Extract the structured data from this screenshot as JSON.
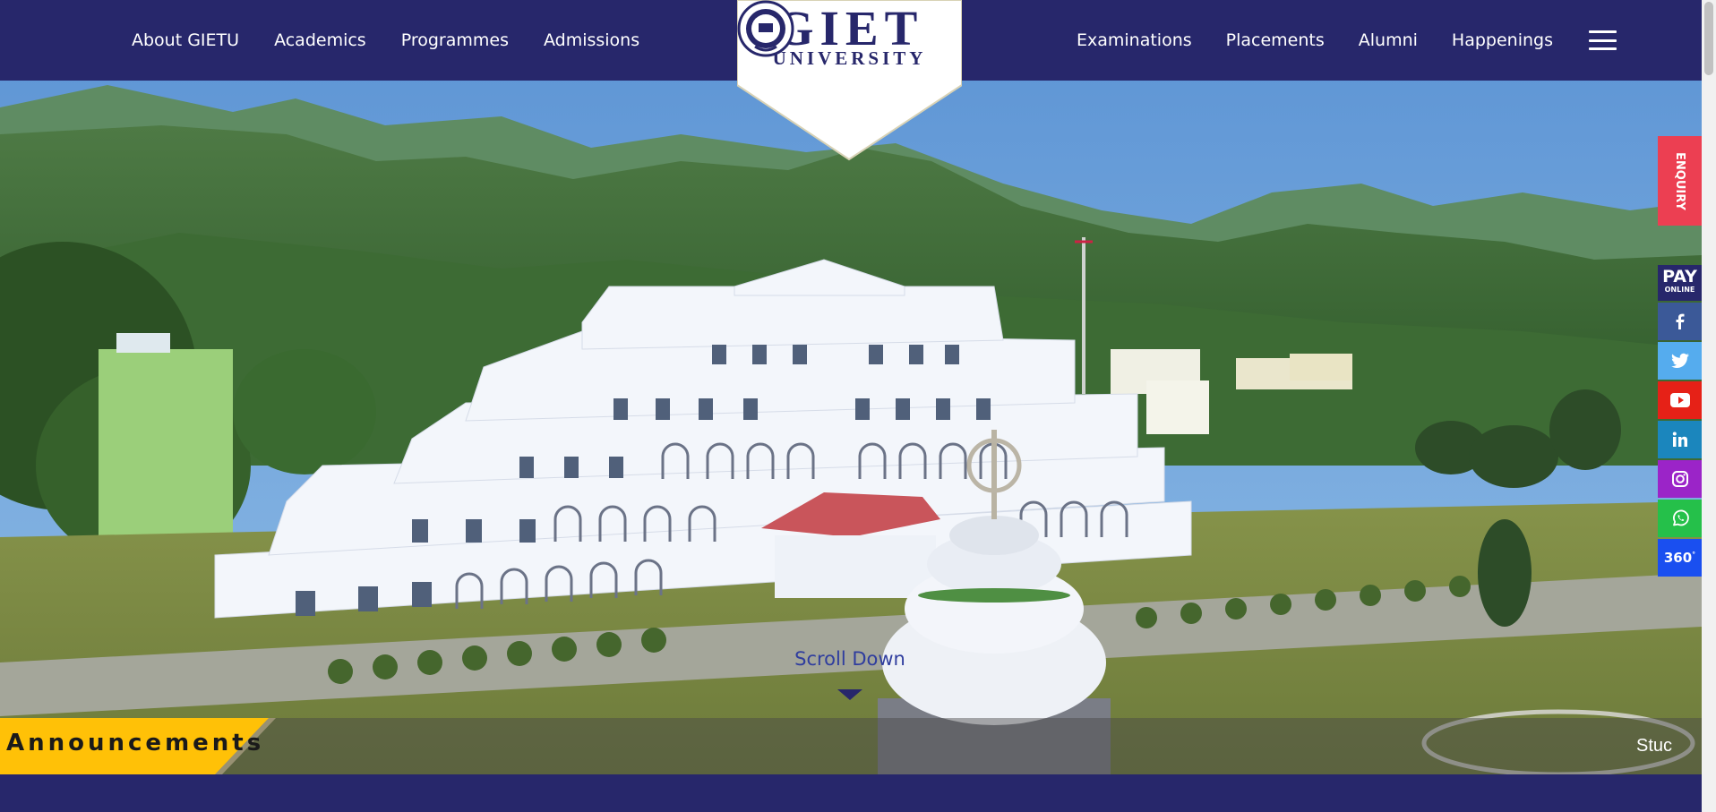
{
  "header": {
    "nav_left": [
      {
        "label": "About GIETU"
      },
      {
        "label": "Academics"
      },
      {
        "label": "Programmes"
      },
      {
        "label": "Admissions"
      }
    ],
    "nav_right": [
      {
        "label": "Examinations"
      },
      {
        "label": "Placements"
      },
      {
        "label": "Alumni"
      },
      {
        "label": "Happenings"
      }
    ]
  },
  "logo": {
    "title": "GIET",
    "subtitle": "UNIVERSITY"
  },
  "hero": {
    "scroll_label": "Scroll Down"
  },
  "announcements": {
    "label": "Announcements",
    "ticker": "Stuc"
  },
  "side_widgets": {
    "enquiry_label": "ENQUIRY",
    "pay_line1": "PAY",
    "pay_line2": "ONLINE",
    "tour_label": "360",
    "tour_sup": "°",
    "socials": [
      {
        "icon": "facebook-icon",
        "color": "#3b5998"
      },
      {
        "icon": "twitter-icon",
        "color": "#55acee"
      },
      {
        "icon": "youtube-icon",
        "color": "#e62117"
      },
      {
        "icon": "linkedin-icon",
        "color": "#1b86bd"
      },
      {
        "icon": "instagram-icon",
        "color": "#9b24c8"
      },
      {
        "icon": "whatsapp-icon",
        "color": "#25c04a"
      },
      {
        "icon": "tour-360-icon",
        "color": "#1a4ff0"
      }
    ]
  },
  "colors": {
    "brand_navy": "#27276b",
    "enquiry_red": "#ec3f52",
    "announcement_yellow": "#ffc107"
  }
}
